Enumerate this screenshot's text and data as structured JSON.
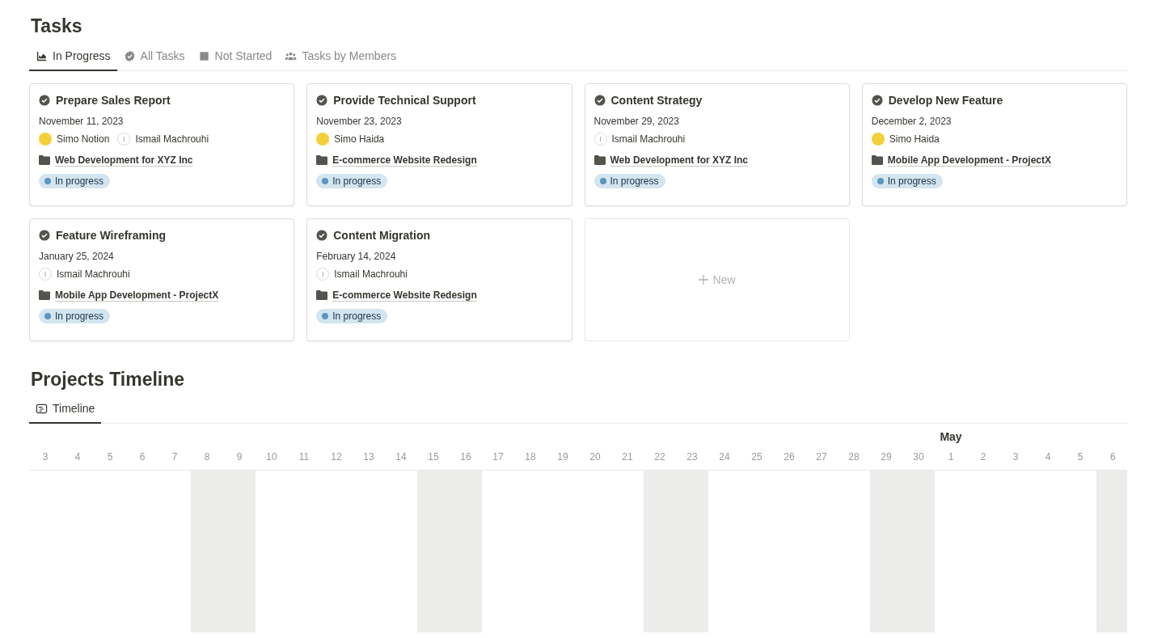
{
  "tasks": {
    "title": "Tasks",
    "tabs": [
      {
        "label": "In Progress",
        "selected": true
      },
      {
        "label": "All Tasks",
        "selected": false
      },
      {
        "label": "Not Started",
        "selected": false
      },
      {
        "label": "Tasks by Members",
        "selected": false
      }
    ],
    "cards": [
      {
        "title": "Prepare Sales Report",
        "date": "November 11, 2023",
        "assignees": [
          {
            "name": "Simo Notion",
            "kind": "photo"
          },
          {
            "name": "Ismail Machrouhi",
            "kind": "initial",
            "initial": "I"
          }
        ],
        "project": "Web Development for XYZ Inc",
        "status": "In progress"
      },
      {
        "title": "Provide Technical Support",
        "date": "November 23, 2023",
        "assignees": [
          {
            "name": "Simo Haida",
            "kind": "photo"
          }
        ],
        "project": "E-commerce Website Redesign",
        "status": "In progress"
      },
      {
        "title": "Content Strategy",
        "date": "November 29, 2023",
        "assignees": [
          {
            "name": "Ismail Machrouhi",
            "kind": "initial",
            "initial": "I"
          }
        ],
        "project": "Web Development for XYZ Inc",
        "status": "In progress"
      },
      {
        "title": "Develop New Feature",
        "date": "December 2, 2023",
        "assignees": [
          {
            "name": "Simo Haida",
            "kind": "photo"
          }
        ],
        "project": "Mobile App Development - ProjectX",
        "status": "In progress"
      },
      {
        "title": "Feature Wireframing",
        "date": "January 25, 2024",
        "assignees": [
          {
            "name": "Ismail Machrouhi",
            "kind": "initial",
            "initial": "I"
          }
        ],
        "project": "Mobile App Development - ProjectX",
        "status": "In progress"
      },
      {
        "title": "Content Migration",
        "date": "February 14, 2024",
        "assignees": [
          {
            "name": "Ismail Machrouhi",
            "kind": "initial",
            "initial": "I"
          }
        ],
        "project": "E-commerce Website Redesign",
        "status": "In progress"
      }
    ],
    "new_card": {
      "label": "New"
    }
  },
  "projects": {
    "title": "Projects Timeline",
    "tabs": [
      {
        "label": "Timeline",
        "selected": true
      }
    ],
    "timeline": {
      "days": [
        {
          "label": "3",
          "weekend": false
        },
        {
          "label": "4",
          "weekend": false
        },
        {
          "label": "5",
          "weekend": false
        },
        {
          "label": "6",
          "weekend": false
        },
        {
          "label": "7",
          "weekend": false
        },
        {
          "label": "8",
          "weekend": true
        },
        {
          "label": "9",
          "weekend": true
        },
        {
          "label": "10",
          "weekend": false
        },
        {
          "label": "11",
          "weekend": false
        },
        {
          "label": "12",
          "weekend": false
        },
        {
          "label": "13",
          "weekend": false
        },
        {
          "label": "14",
          "weekend": false
        },
        {
          "label": "15",
          "weekend": true
        },
        {
          "label": "16",
          "weekend": true
        },
        {
          "label": "17",
          "weekend": false
        },
        {
          "label": "18",
          "weekend": false
        },
        {
          "label": "19",
          "weekend": false
        },
        {
          "label": "20",
          "weekend": false
        },
        {
          "label": "21",
          "weekend": false
        },
        {
          "label": "22",
          "weekend": true
        },
        {
          "label": "23",
          "weekend": true
        },
        {
          "label": "24",
          "weekend": false
        },
        {
          "label": "25",
          "weekend": false
        },
        {
          "label": "26",
          "weekend": false
        },
        {
          "label": "27",
          "weekend": false
        },
        {
          "label": "28",
          "weekend": false
        },
        {
          "label": "29",
          "weekend": true
        },
        {
          "label": "30",
          "weekend": true
        },
        {
          "label": "1",
          "weekend": false,
          "month": "May"
        },
        {
          "label": "2",
          "weekend": false
        },
        {
          "label": "3",
          "weekend": false
        },
        {
          "label": "4",
          "weekend": false
        },
        {
          "label": "5",
          "weekend": false
        },
        {
          "label": "6",
          "weekend": true
        }
      ]
    }
  }
}
